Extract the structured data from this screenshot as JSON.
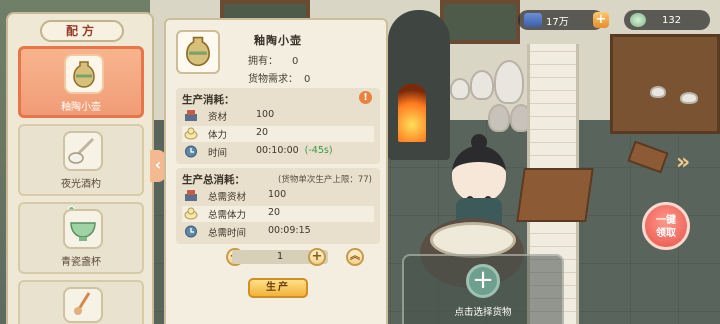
{
  "hud": {
    "currency_value": "17万",
    "gem_value": "132",
    "plus_symbol": "+"
  },
  "left_panel": {
    "title": "配方",
    "items": [
      {
        "label": "釉陶小壶",
        "selected": true
      },
      {
        "label": "夜光酒杓",
        "selected": false
      },
      {
        "label": "青瓷盏杯",
        "selected": false
      },
      {
        "label": "",
        "selected": false
      }
    ]
  },
  "detail": {
    "name": "釉陶小壶",
    "owned_label": "拥有：",
    "owned_value": "0",
    "demand_label": "货物需求：",
    "demand_value": "0",
    "cost": {
      "title": "生产消耗：",
      "rows": [
        {
          "icon": "material-icon",
          "label": "资材",
          "value": "100"
        },
        {
          "icon": "stamina-icon",
          "label": "体力",
          "value": "20"
        },
        {
          "icon": "clock-icon",
          "label": "时间",
          "value": "00:10:00",
          "bonus": "(-45s)"
        }
      ]
    },
    "total": {
      "title": "生产总消耗：",
      "hint": "(货物单次生产上限：77)",
      "rows": [
        {
          "icon": "material-icon",
          "label": "总需资材",
          "value": "100"
        },
        {
          "icon": "stamina-icon",
          "label": "总需体力",
          "value": "20"
        },
        {
          "icon": "clock-icon",
          "label": "总需时间",
          "value": "00:09:15"
        }
      ]
    },
    "quantity": "1",
    "minus_symbol": "−",
    "plus_symbol": "+",
    "max_symbol": "︽",
    "produce_label": "生产"
  },
  "select_slot": {
    "label": "点击选择货物",
    "plus_symbol": "+"
  },
  "collect_button": {
    "line1": "一键",
    "line2": "领取"
  },
  "collapse_symbol": "‹",
  "next_symbol": "»",
  "colors": {
    "accent_orange": "#e8744c",
    "panel_bg": "#f4eee0",
    "bonus_green": "#3a9b49",
    "title_red": "#9a3c29"
  }
}
